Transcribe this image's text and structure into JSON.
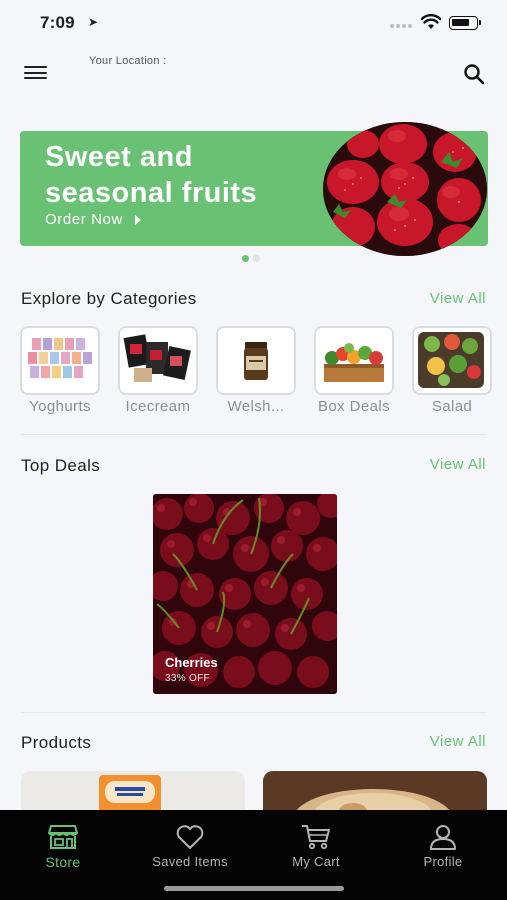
{
  "status_bar": {
    "time": "7:09"
  },
  "header": {
    "location_label": "Your Location :"
  },
  "banner": {
    "title": "Sweet and seasonal fruits",
    "cta": "Order Now",
    "slide_index": 1,
    "slide_count": 2
  },
  "categories": {
    "title": "Explore by Categories",
    "view_all": "View All",
    "items": [
      {
        "label": "Yoghurts"
      },
      {
        "label": "Icecream"
      },
      {
        "label": "Welsh..."
      },
      {
        "label": "Box Deals"
      },
      {
        "label": "Salad"
      }
    ]
  },
  "top_deals": {
    "title": "Top Deals",
    "view_all": "View All",
    "items": [
      {
        "name": "Cherries",
        "discount": "33% OFF"
      }
    ]
  },
  "products": {
    "title": "Products",
    "view_all": "View All"
  },
  "tab_bar": {
    "tabs": [
      {
        "label": "Store",
        "icon": "store-icon",
        "active": true
      },
      {
        "label": "Saved Items",
        "icon": "heart-icon",
        "active": false
      },
      {
        "label": "My Cart",
        "icon": "cart-icon",
        "active": false
      },
      {
        "label": "Profile",
        "icon": "person-icon",
        "active": false
      }
    ]
  },
  "colors": {
    "accent": "#69c173",
    "background": "#f4f6f9",
    "tab_bar": "#040404"
  }
}
